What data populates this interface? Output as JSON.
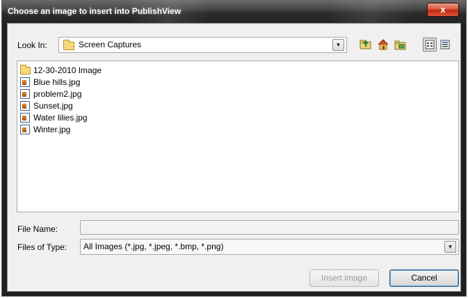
{
  "dialog": {
    "title": "Choose an image to insert into PublishView",
    "close_glyph": "x"
  },
  "look_in": {
    "label": "Look In:",
    "value": "Screen Captures",
    "icon": "folder-icon"
  },
  "toolbar": {
    "up_icon": "up-one-level-icon",
    "home_icon": "home-icon",
    "new_folder_icon": "new-folder-icon",
    "list_view_icon": "list-view-icon",
    "details_view_icon": "details-view-icon"
  },
  "files": [
    {
      "name": "12-30-2010 Image",
      "type": "folder"
    },
    {
      "name": "Blue hills.jpg",
      "type": "image"
    },
    {
      "name": "problem2.jpg",
      "type": "image"
    },
    {
      "name": "Sunset.jpg",
      "type": "image"
    },
    {
      "name": "Water lilies.jpg",
      "type": "image"
    },
    {
      "name": "Winter.jpg",
      "type": "image"
    }
  ],
  "file_name": {
    "label": "File Name:",
    "value": ""
  },
  "file_type": {
    "label": "Files of Type:",
    "value": "All Images (*.jpg, *.jpeg, *.bmp, *.png)"
  },
  "buttons": {
    "insert": "Insert image",
    "cancel": "Cancel"
  },
  "colors": {
    "titlebar": "#2a2a2a",
    "close": "#c12a10",
    "folder": "#f7d87c"
  }
}
